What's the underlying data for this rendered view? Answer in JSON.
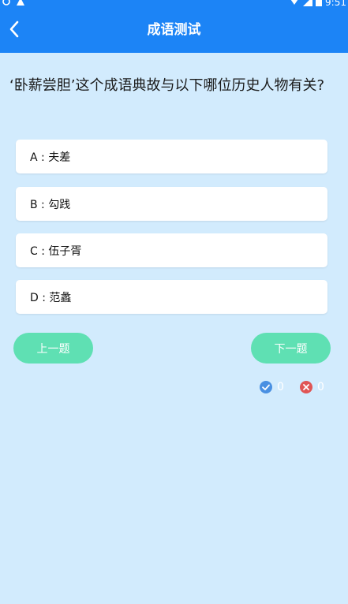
{
  "status_bar": {
    "time": "9:51",
    "icons": [
      "sync-icon",
      "alert-icon",
      "wifi-icon",
      "signal-icon",
      "battery-icon"
    ]
  },
  "header": {
    "title": "成语测试",
    "back_icon": "back-arrow-icon"
  },
  "question": {
    "text": "‘卧薪尝胆’这个成语典故与以下哪位历史人物有关?"
  },
  "options": [
    {
      "label": "A : 夫差"
    },
    {
      "label": "B : 勾践"
    },
    {
      "label": "C : 伍子胥"
    },
    {
      "label": "D : 范蠡"
    }
  ],
  "navigation": {
    "prev_label": "上一题",
    "next_label": "下一题"
  },
  "score": {
    "correct": "0",
    "wrong": "0"
  },
  "colors": {
    "primary": "#1c84f6",
    "background": "#d2ebfd",
    "button": "#5fe0b3",
    "correct": "#4a90e2",
    "wrong": "#e05555"
  }
}
